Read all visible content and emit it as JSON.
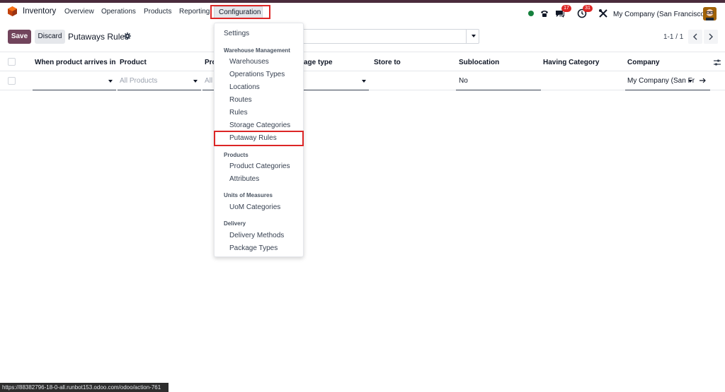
{
  "navbar": {
    "app_name": "Inventory",
    "menu": [
      "Overview",
      "Operations",
      "Products",
      "Reporting",
      "Configuration"
    ],
    "messages_badge": "17",
    "activities_badge": "31",
    "company": "My Company (San Francisco)"
  },
  "control_panel": {
    "save_label": "Save",
    "discard_label": "Discard",
    "title": "Putaways Rules",
    "pager_value": "1-1 / 1"
  },
  "table": {
    "columns": [
      "When product arrives in",
      "Product",
      "Pro",
      "age type",
      "Store to",
      "Sublocation",
      "Having Category",
      "Company"
    ],
    "row": {
      "product_placeholder": "All Products",
      "product_category_placeholder": "All",
      "sublocation": "No",
      "company": "My Company (San Fr"
    }
  },
  "dropdown": {
    "settings": "Settings",
    "sections": [
      {
        "header": "Warehouse Management",
        "items": [
          "Warehouses",
          "Operations Types",
          "Locations",
          "Routes",
          "Rules",
          "Storage Categories",
          "Putaway Rules"
        ]
      },
      {
        "header": "Products",
        "items": [
          "Product Categories",
          "Attributes"
        ]
      },
      {
        "header": "Units of Measures",
        "items": [
          "UoM Categories"
        ]
      },
      {
        "header": "Delivery",
        "items": [
          "Delivery Methods",
          "Package Types"
        ]
      }
    ]
  },
  "status_url": "https://88382796-18-0-all.runbot153.odoo.com/odoo/action-761",
  "colors": {
    "brand": "#71445c",
    "highlight": "#dc2626",
    "online": "#15803d"
  }
}
